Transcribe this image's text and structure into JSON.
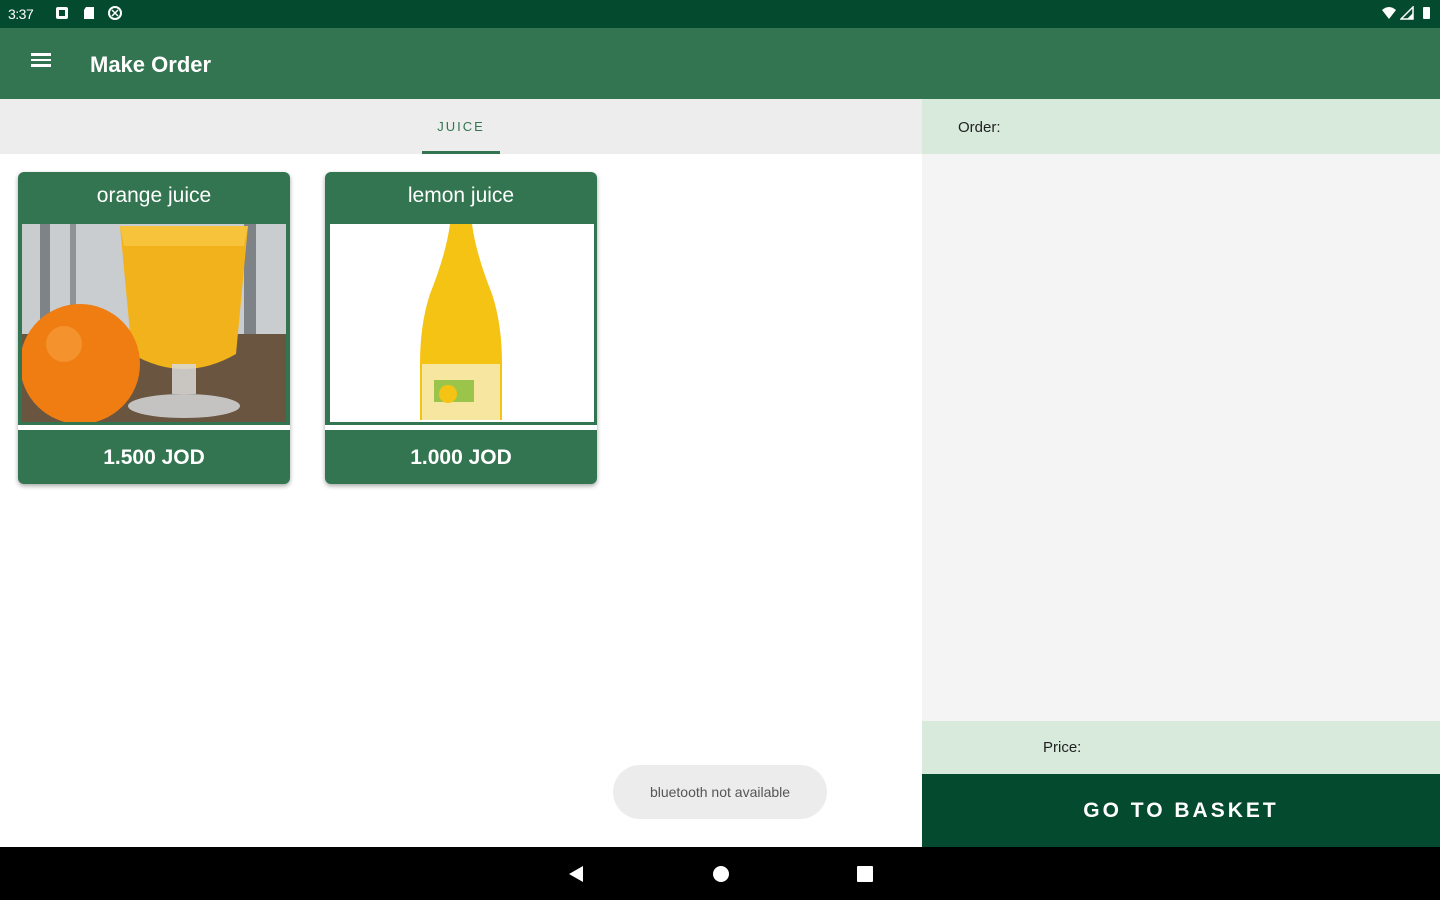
{
  "status_bar": {
    "time": "3:37"
  },
  "app_bar": {
    "title": "Make Order",
    "menu_icon": "menu-icon"
  },
  "tabs": [
    {
      "label": "JUICE",
      "selected": true
    }
  ],
  "products": [
    {
      "name": "orange juice",
      "price": "1.500 JOD"
    },
    {
      "name": "lemon juice",
      "price": "1.000 JOD"
    }
  ],
  "order_panel": {
    "order_label": "Order:",
    "price_label": "Price:",
    "basket_button": "GO TO BASKET"
  },
  "toast": {
    "message": "bluetooth not available"
  },
  "colors": {
    "primary": "#327550",
    "primary_dark": "#044a2e",
    "panel_header": "#d7eadc",
    "panel_bg": "#f4f4f4"
  }
}
